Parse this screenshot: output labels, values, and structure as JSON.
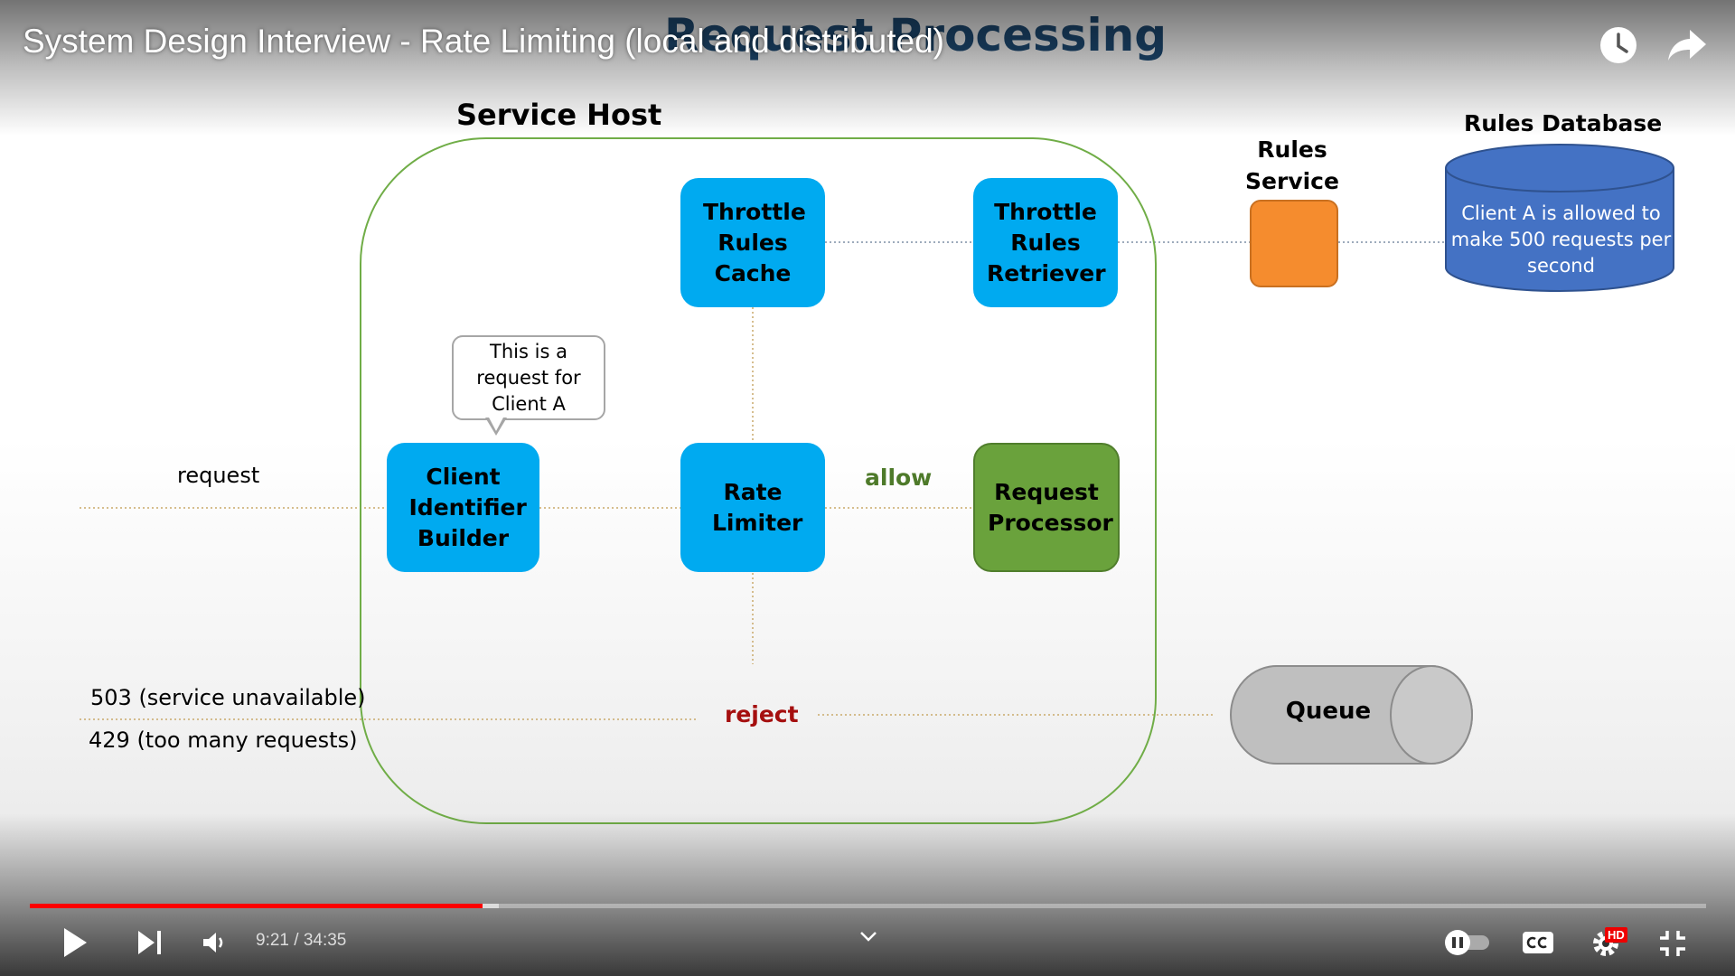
{
  "video": {
    "title": "System Design Interview - Rate Limiting (local and distributed)",
    "time_current": "9:21",
    "time_separator": " / ",
    "time_total": "34:35",
    "progress": 0.27,
    "buffered": 0.28,
    "hd_badge": "HD"
  },
  "slide": {
    "title": "Request Processing",
    "service_host_label": "Service Host",
    "throttle_rules_cache": "Throttle Rules Cache",
    "throttle_rules_retriever": "Throttle Rules Retriever",
    "rules_service_label": "Rules Service",
    "rules_database_label": "Rules Database",
    "rules_database_text": "Client A is allowed to make 500 requests per second",
    "bubble_text": "This is a request for Client A",
    "request_label": "request",
    "client_identifier_builder": "Client Identifier Builder",
    "rate_limiter": "Rate Limiter",
    "allow_label": "allow",
    "request_processor": "Request Processor",
    "status_503": "503 (service unavailable)",
    "status_429": "429 (too many requests)",
    "reject_label": "reject",
    "queue_label": "Queue"
  },
  "colors": {
    "component_blue": "#00aaf0",
    "processor_green": "#6aa23c",
    "rules_service_orange": "#f58c2e",
    "database_blue": "#4472c4",
    "title_blue": "#1f4e79",
    "allow_green": "#4e7a2a",
    "reject_red": "#a50f0f",
    "progress_red": "#ff0000"
  },
  "icons": {
    "watch_later": "clock-icon",
    "share": "share-arrow-icon",
    "play": "play-icon",
    "next": "next-icon",
    "volume": "volume-icon",
    "expand": "chevron-down-icon",
    "autoplay": "autoplay-toggle-icon",
    "captions": "cc-icon",
    "settings": "gear-icon",
    "exit_fullscreen": "exit-fullscreen-icon"
  }
}
